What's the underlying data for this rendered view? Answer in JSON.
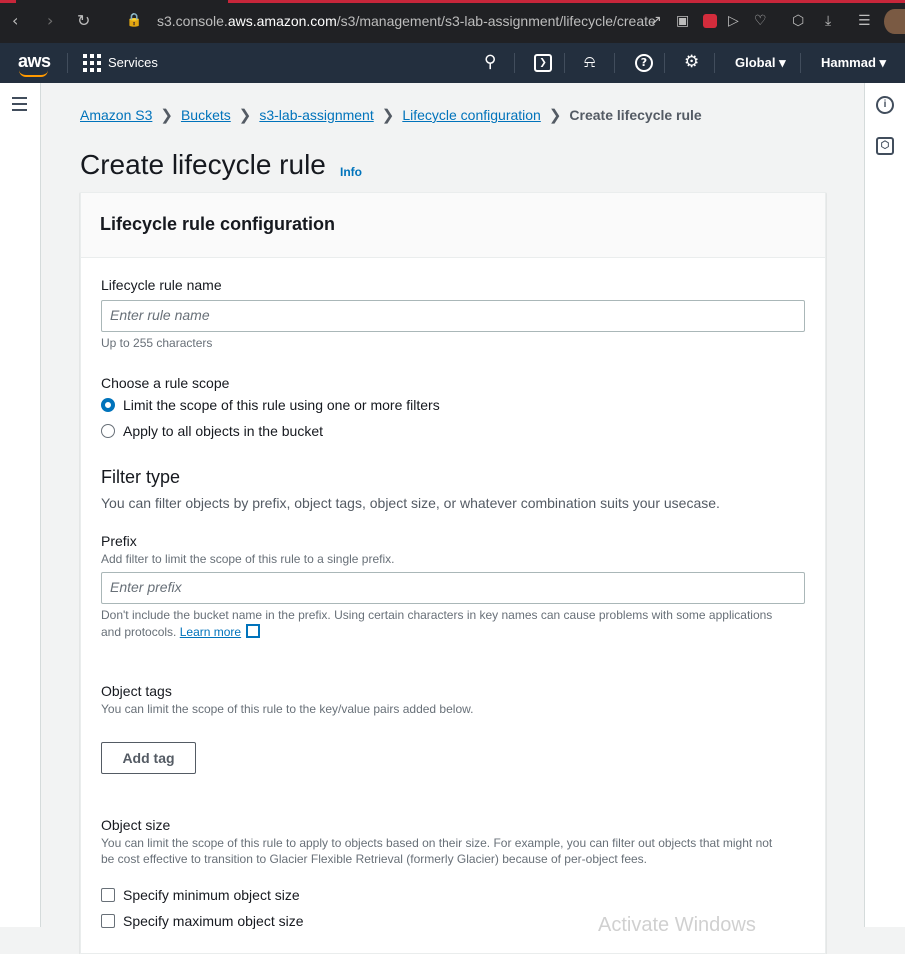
{
  "browser": {
    "url_prefix": "s3.console.",
    "url_domain": "aws.amazon.com",
    "url_path": "/s3/management/s3-lab-assignment/lifecycle/create"
  },
  "aws_nav": {
    "logo": "aws",
    "services_label": "Services",
    "region_label": "Global",
    "user_label": "Hammad",
    "accent_color": "#ff9900",
    "nav_bg": "#232f3e"
  },
  "breadcrumb": {
    "items": [
      "Amazon S3",
      "Buckets",
      "s3-lab-assignment",
      "Lifecycle configuration"
    ],
    "current": "Create lifecycle rule"
  },
  "page": {
    "title": "Create lifecycle rule",
    "info_label": "Info"
  },
  "card": {
    "title": "Lifecycle rule configuration",
    "rule_name": {
      "label": "Lifecycle rule name",
      "placeholder": "Enter rule name",
      "value": "",
      "hint": "Up to 255 characters"
    },
    "scope": {
      "label": "Choose a rule scope",
      "options": [
        "Limit the scope of this rule using one or more filters",
        "Apply to all objects in the bucket"
      ],
      "selected": "Limit the scope of this rule using one or more filters"
    },
    "filter": {
      "title": "Filter type",
      "desc": "You can filter objects by prefix, object tags, object size, or whatever combination suits your usecase."
    },
    "prefix": {
      "label": "Prefix",
      "desc": "Add filter to limit the scope of this rule to a single prefix.",
      "placeholder": "Enter prefix",
      "value": "",
      "note_line1": "Don't include the bucket name in the prefix. Using certain characters in key names can cause problems with some applications",
      "note_line2": "and protocols.",
      "learn_more": "Learn more"
    },
    "tags": {
      "label": "Object tags",
      "desc": "You can limit the scope of this rule to the key/value pairs added below.",
      "add_button": "Add tag"
    },
    "size": {
      "label": "Object size",
      "desc_line1": "You can limit the scope of this rule to apply to objects based on their size. For example, you can filter out objects that might not",
      "desc_line2": "be cost effective to transition to Glacier Flexible Retrieval (formerly Glacier) because of per-object fees.",
      "min_label": "Specify minimum object size",
      "max_label": "Specify maximum object size"
    }
  },
  "watermark": "Activate Windows"
}
